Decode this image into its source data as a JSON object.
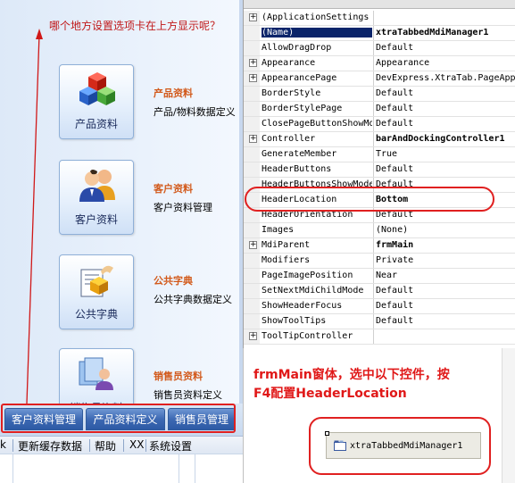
{
  "left_panel": {
    "question": "哪个地方设置选项卡在上方显示呢？",
    "tiles": [
      {
        "label": "产品资料",
        "title": "产品资料",
        "desc": "产品/物料数据定义",
        "icon": "cubes-icon"
      },
      {
        "label": "客户资料",
        "title": "客户资料",
        "desc": "客户资料管理",
        "icon": "users-icon"
      },
      {
        "label": "公共字典",
        "title": "公共字典",
        "desc": "公共字典数据定义",
        "icon": "dictionary-icon"
      },
      {
        "label": "销售员资料",
        "title": "销售员资料",
        "desc": "销售员资料定义",
        "icon": "salesperson-icon"
      }
    ],
    "tabs": [
      "客户资料管理",
      "产品资料定义",
      "销售员管理"
    ],
    "statusbar": [
      "k",
      "更新缓存数据",
      "帮助",
      "XX",
      "系统设置"
    ]
  },
  "property_grid": {
    "rows": [
      {
        "name": "(ApplicationSettings",
        "value": "",
        "expandable": true
      },
      {
        "name": "(Name)",
        "value": "xtraTabbedMdiManager1",
        "bold": true,
        "selected": true
      },
      {
        "name": "AllowDragDrop",
        "value": "Default"
      },
      {
        "name": "Appearance",
        "value": "Appearance",
        "expandable": true
      },
      {
        "name": "AppearancePage",
        "value": "DevExpress.XtraTab.PageAppearance",
        "expandable": true
      },
      {
        "name": "BorderStyle",
        "value": "Default"
      },
      {
        "name": "BorderStylePage",
        "value": "Default"
      },
      {
        "name": "ClosePageButtonShowMode",
        "value": "Default"
      },
      {
        "name": "Controller",
        "value": "barAndDockingController1",
        "bold": true,
        "expandable": true
      },
      {
        "name": "GenerateMember",
        "value": "True"
      },
      {
        "name": "HeaderButtons",
        "value": "Default"
      },
      {
        "name": "HeaderButtonsShowMode",
        "value": "Default"
      },
      {
        "name": "HeaderLocation",
        "value": "Bottom",
        "bold": true
      },
      {
        "name": "HeaderOrientation",
        "value": "Default"
      },
      {
        "name": "Images",
        "value": "(None)"
      },
      {
        "name": "MdiParent",
        "value": "frmMain",
        "bold": true,
        "expandable": true
      },
      {
        "name": "Modifiers",
        "value": "Private"
      },
      {
        "name": "PageImagePosition",
        "value": "Near"
      },
      {
        "name": "SetNextMdiChildMode",
        "value": "Default"
      },
      {
        "name": "ShowHeaderFocus",
        "value": "Default"
      },
      {
        "name": "ShowToolTips",
        "value": "Default"
      },
      {
        "name": "ToolTipController",
        "value": "",
        "expandable": true
      }
    ]
  },
  "annotation": {
    "line1": "frmMain窗体，选中以下控件，按",
    "line2": "F4配置HeaderLocation"
  },
  "component_tray": {
    "label": "xtraTabbedMdiManager1"
  },
  "colors": {
    "annotation_red": "#e02020",
    "category_orange": "#d2591a",
    "tab_blue": "#3d69b3",
    "selected_row": "#0a246a"
  }
}
